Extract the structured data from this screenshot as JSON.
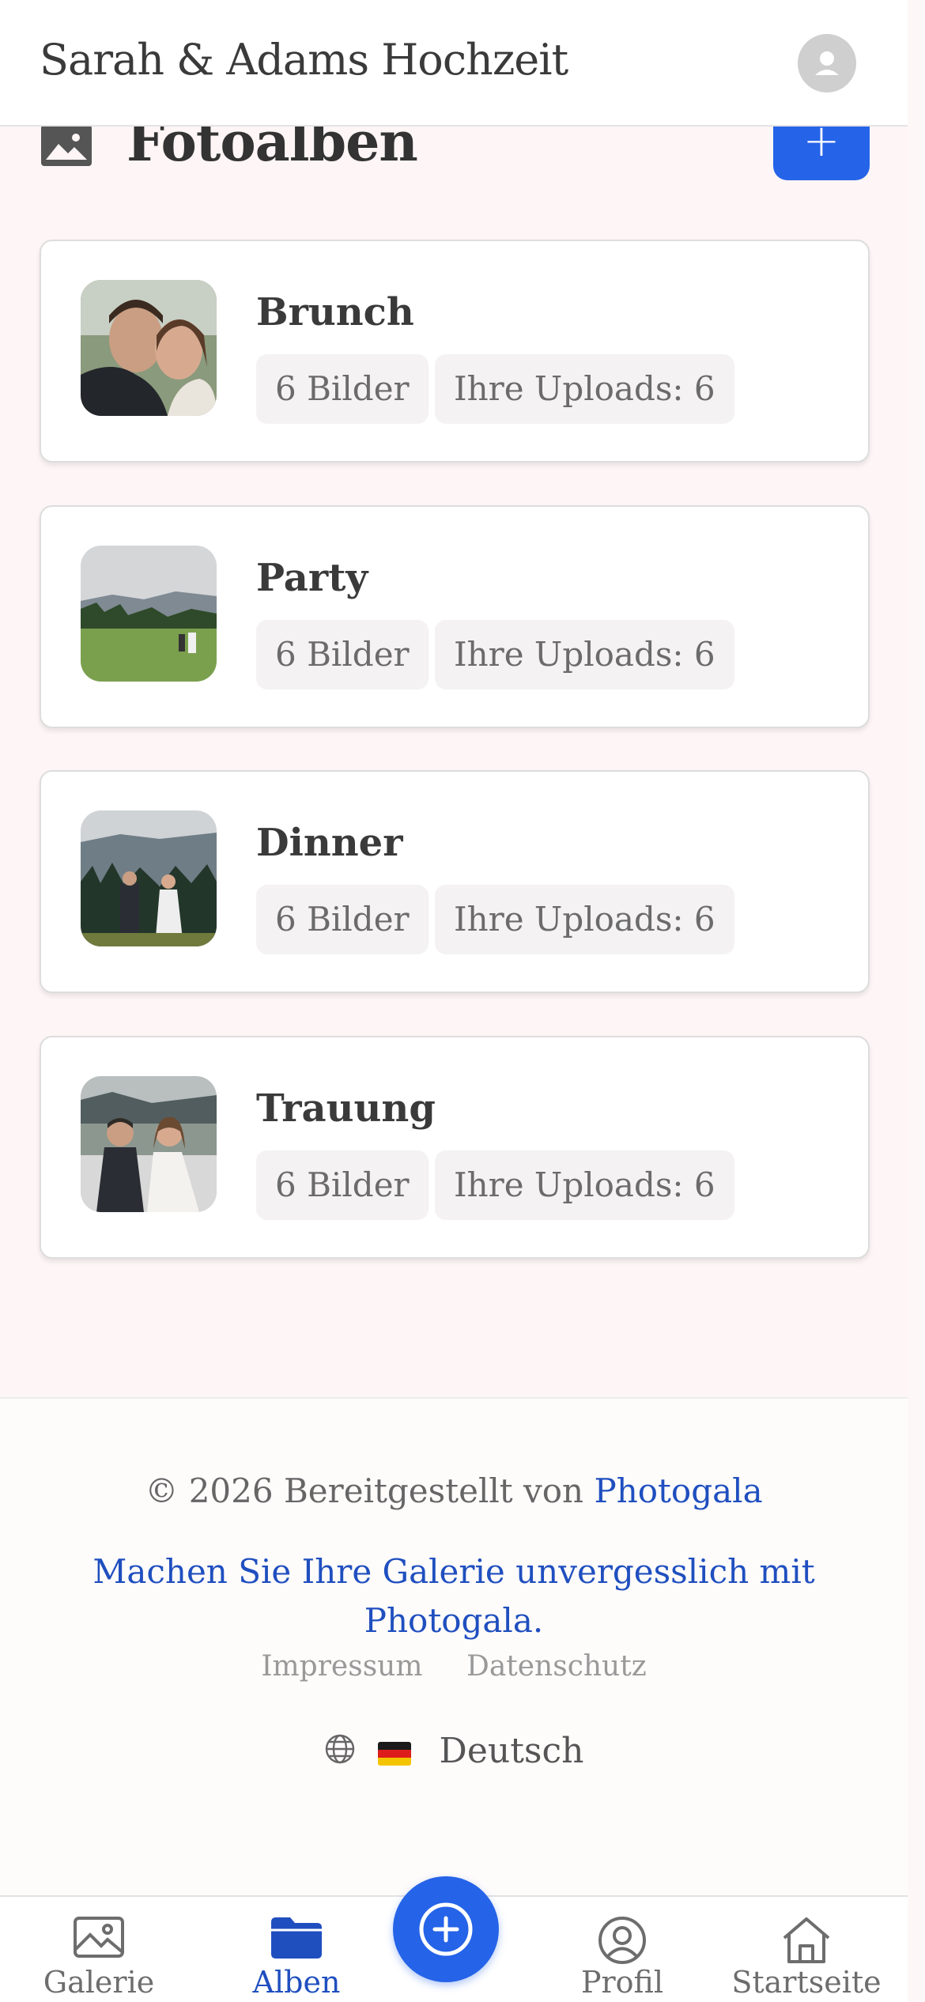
{
  "header": {
    "title": "Sarah & Adams Hochzeit",
    "avatar_icon": "user-avatar-icon"
  },
  "albums_section": {
    "title": "Fotoalben",
    "icon": "image-icon",
    "add_button_label": "+"
  },
  "albums": [
    {
      "name": "Brunch",
      "count_label": "6 Bilder",
      "uploads_label": "Ihre Uploads: 6"
    },
    {
      "name": "Party",
      "count_label": "6 Bilder",
      "uploads_label": "Ihre Uploads: 6"
    },
    {
      "name": "Dinner",
      "count_label": "6 Bilder",
      "uploads_label": "Ihre Uploads: 6"
    },
    {
      "name": "Trauung",
      "count_label": "6 Bilder",
      "uploads_label": "Ihre Uploads: 6"
    }
  ],
  "footer": {
    "copyright_prefix": "© 2026 Bereitgestellt von ",
    "brand_link": "Photogala",
    "tagline": "Machen Sie Ihre Galerie unvergesslich mit Photogala.",
    "links": [
      "Impressum",
      "Datenschutz"
    ],
    "language": "Deutsch"
  },
  "bottom_nav": {
    "items": [
      {
        "label": "Galerie",
        "icon": "gallery-icon"
      },
      {
        "label": "Alben",
        "icon": "folder-icon"
      },
      {
        "label": "Profil",
        "icon": "profile-icon"
      },
      {
        "label": "Startseite",
        "icon": "home-icon"
      }
    ],
    "active": "Alben",
    "fab_icon": "plus-circle-icon"
  },
  "colors": {
    "accent": "#2563e8",
    "link": "#1f4fbf",
    "page_background": "#fdf5f6"
  }
}
